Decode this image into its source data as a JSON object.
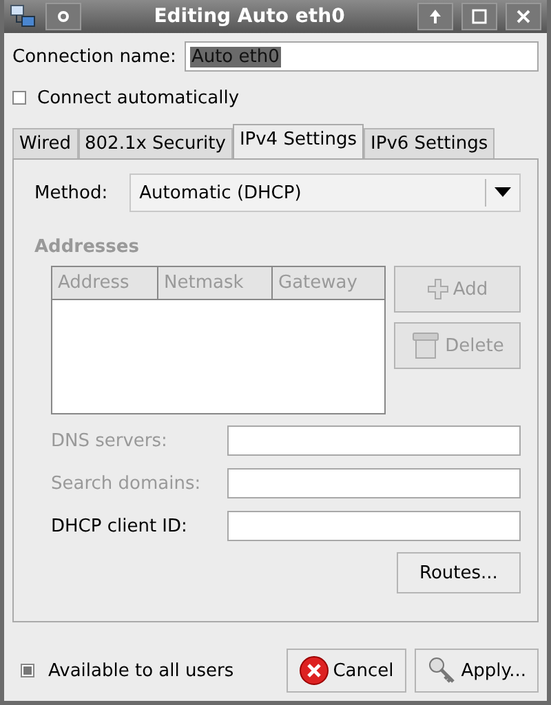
{
  "window": {
    "title": "Editing Auto eth0"
  },
  "connection_name": {
    "label": "Connection name:",
    "value": "Auto eth0"
  },
  "connect_automatically": {
    "label": "Connect automatically",
    "checked": false
  },
  "tabs": [
    {
      "label": "Wired",
      "selected": false
    },
    {
      "label": "802.1x Security",
      "selected": false
    },
    {
      "label": "IPv4 Settings",
      "selected": true
    },
    {
      "label": "IPv6 Settings",
      "selected": false
    }
  ],
  "method": {
    "label": "Method:",
    "value": "Automatic (DHCP)"
  },
  "addresses": {
    "heading": "Addresses",
    "disabled": true,
    "columns": [
      "Address",
      "Netmask",
      "Gateway"
    ],
    "buttons": [
      {
        "kind": "add",
        "label": "Add",
        "disabled": true
      },
      {
        "kind": "delete",
        "label": "Delete",
        "disabled": true
      }
    ]
  },
  "fields": [
    {
      "label": "DNS servers:",
      "disabled": true
    },
    {
      "label": "Search domains:",
      "disabled": true
    },
    {
      "label": "DHCP client ID:",
      "disabled": false
    }
  ],
  "routes_button": "Routes...",
  "available_to_all_users": {
    "label": "Available to all users",
    "checked": true
  },
  "buttons": [
    {
      "kind": "cancel",
      "label": "Cancel"
    },
    {
      "kind": "apply",
      "label": "Apply..."
    }
  ]
}
